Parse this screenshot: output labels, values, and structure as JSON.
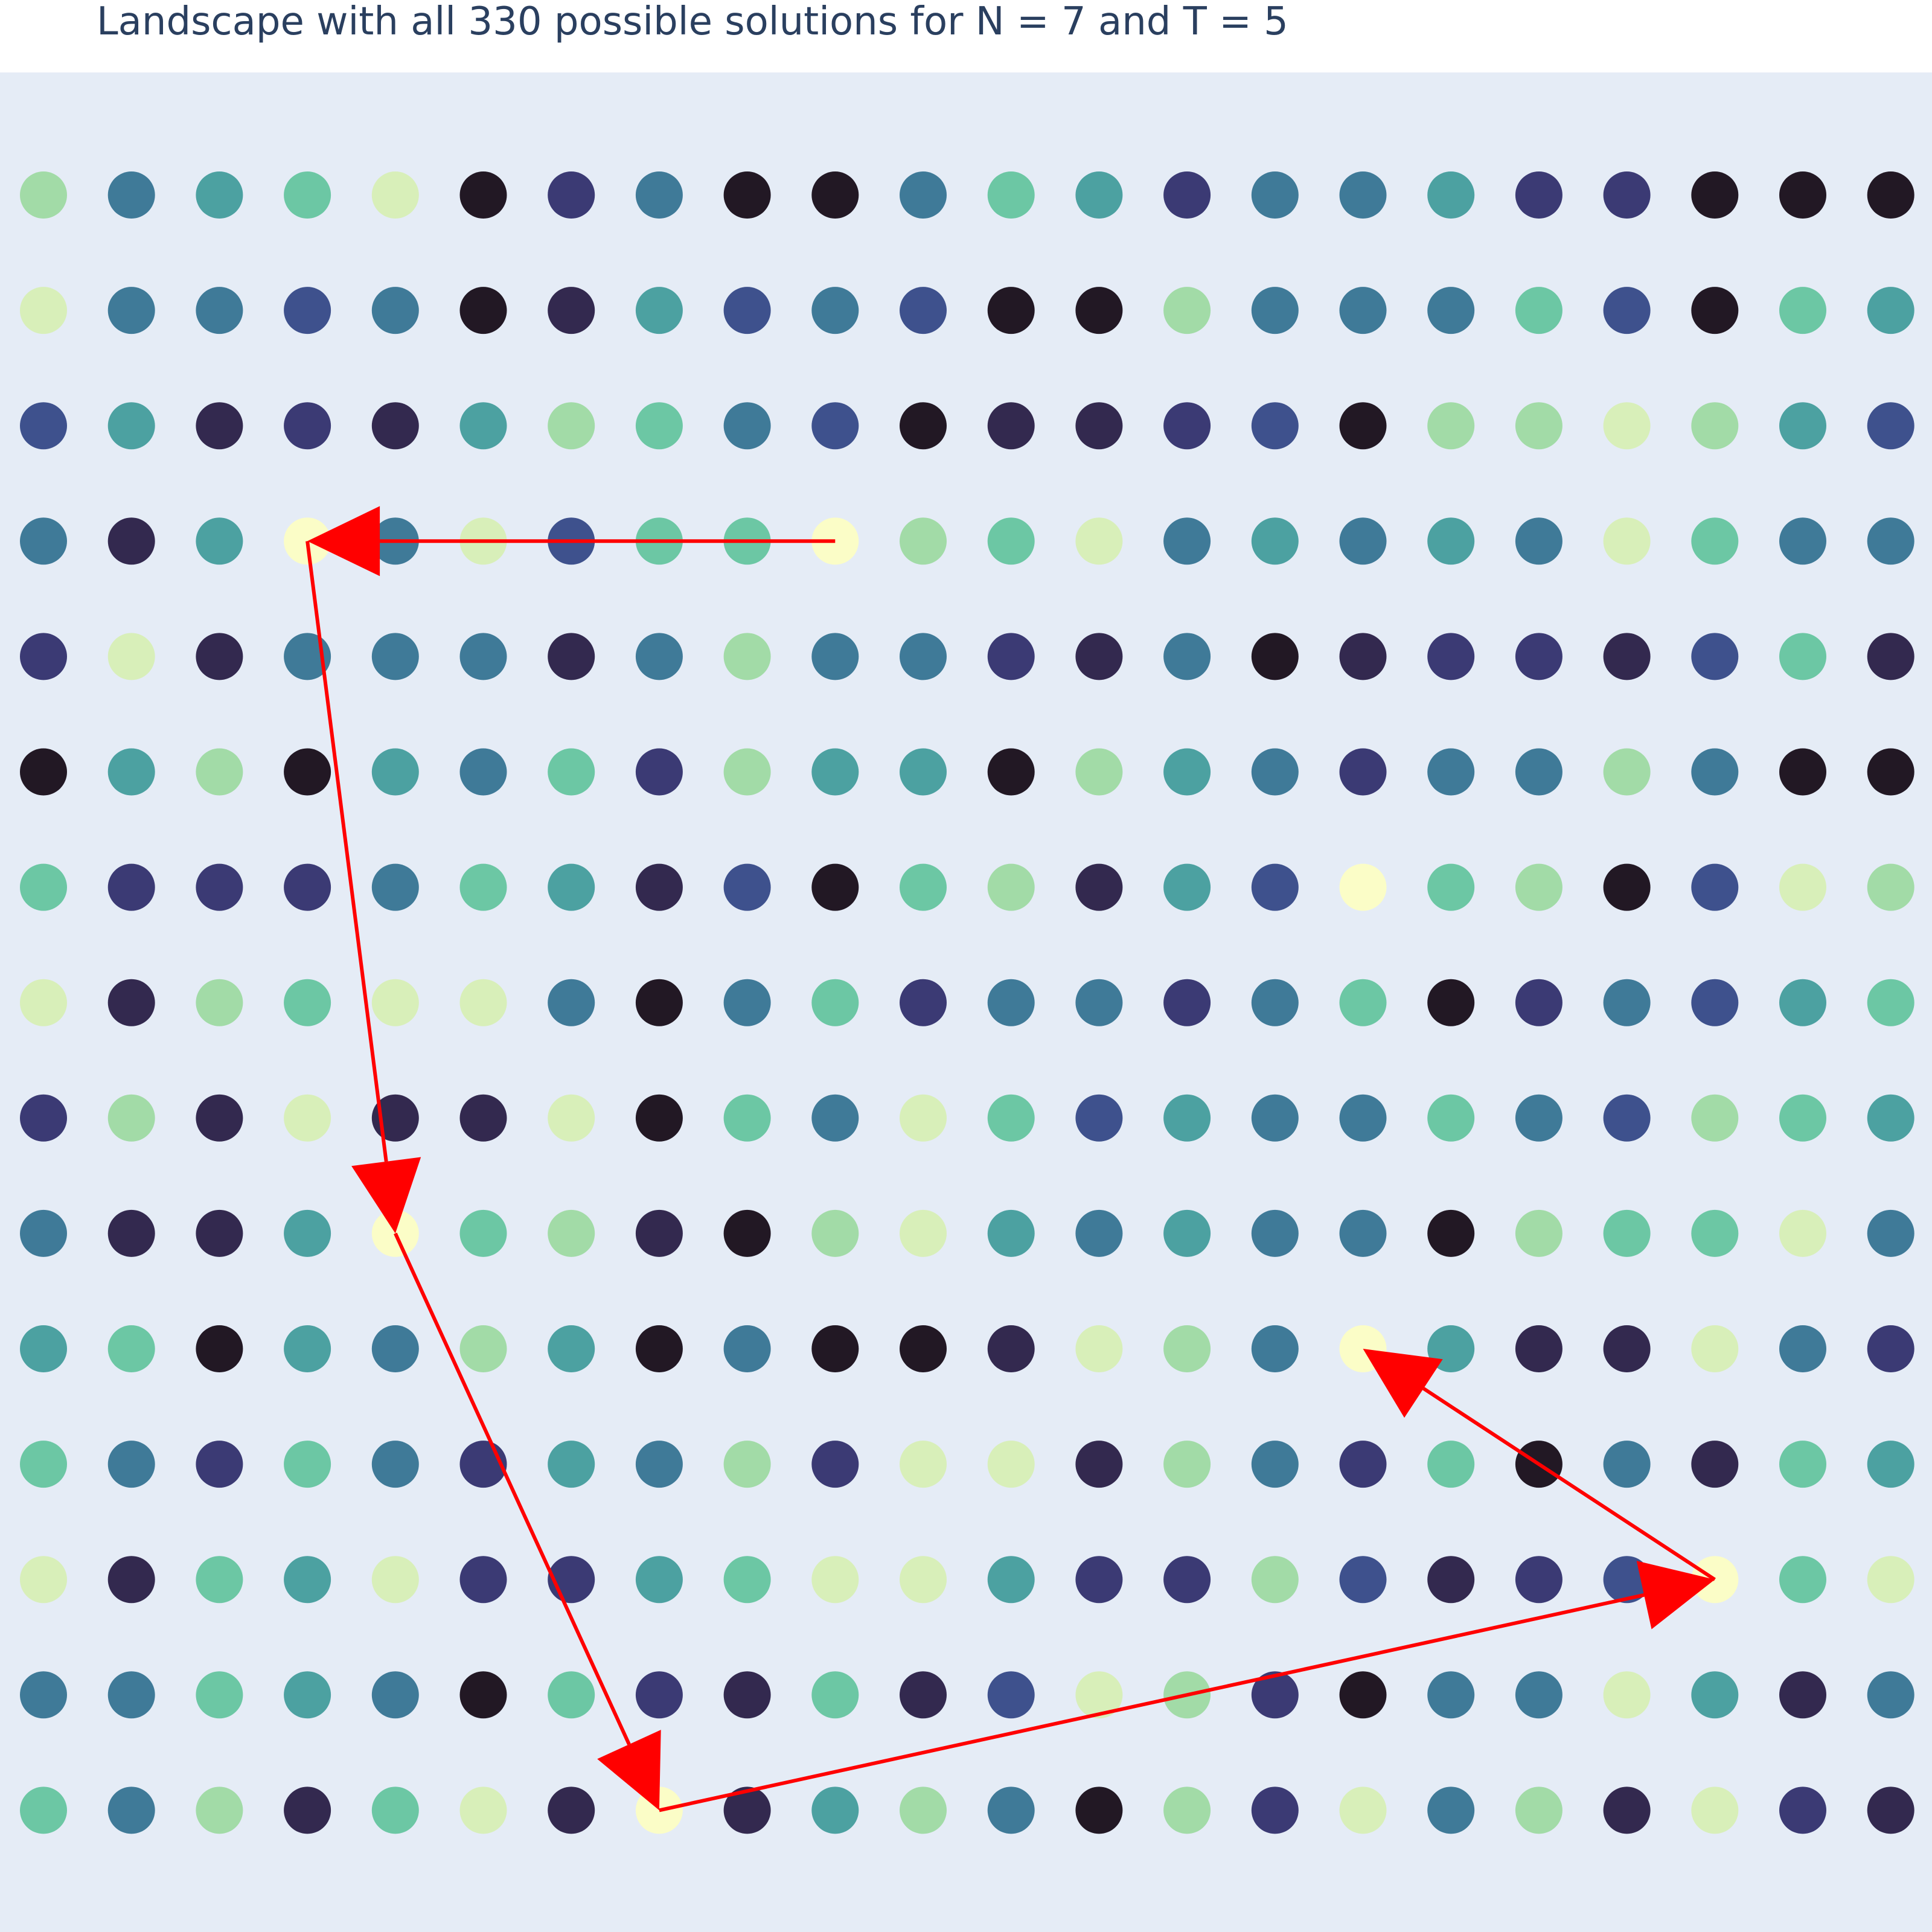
{
  "chart_data": {
    "type": "scatter",
    "title": "Landscape with all 330 possible solutions for N = 7 and T = 5",
    "xlabel": "",
    "ylabel": "",
    "grid": false,
    "colorscale": [
      "#fbfdc7",
      "#d8efb9",
      "#a2dba7",
      "#6cc7a4",
      "#4ca1a1",
      "#3f7a98",
      "#3e518d",
      "#3b3a74",
      "#33294f",
      "#221824"
    ],
    "grid_rows": 15,
    "grid_cols": 22,
    "point_levels": [
      [
        2,
        5,
        4,
        3,
        1,
        9,
        7,
        5,
        9,
        9,
        5,
        3,
        4,
        7,
        5,
        5,
        4,
        7,
        7,
        9,
        9,
        9
      ],
      [
        1,
        5,
        5,
        6,
        5,
        9,
        8,
        4,
        6,
        5,
        6,
        9,
        9,
        2,
        5,
        5,
        5,
        3,
        6,
        9,
        3,
        4
      ],
      [
        6,
        4,
        8,
        7,
        8,
        4,
        2,
        3,
        5,
        6,
        9,
        8,
        8,
        7,
        6,
        9,
        2,
        2,
        1,
        2,
        4,
        6
      ],
      [
        5,
        8,
        4,
        0,
        5,
        1,
        6,
        3,
        3,
        0,
        2,
        3,
        1,
        5,
        4,
        5,
        4,
        5,
        1,
        3,
        5,
        5
      ],
      [
        7,
        1,
        8,
        5,
        5,
        5,
        8,
        5,
        2,
        5,
        5,
        7,
        8,
        5,
        9,
        8,
        7,
        7,
        8,
        6,
        3,
        8
      ],
      [
        9,
        4,
        2,
        9,
        4,
        5,
        3,
        7,
        2,
        4,
        4,
        9,
        2,
        4,
        5,
        7,
        5,
        5,
        2,
        5,
        9,
        9
      ],
      [
        3,
        7,
        7,
        7,
        5,
        3,
        4,
        8,
        6,
        9,
        3,
        2,
        8,
        4,
        6,
        0,
        3,
        2,
        9,
        6,
        1,
        2
      ],
      [
        1,
        8,
        2,
        3,
        1,
        1,
        5,
        9,
        5,
        3,
        7,
        5,
        5,
        7,
        5,
        3,
        9,
        7,
        5,
        6,
        4,
        3
      ],
      [
        7,
        2,
        8,
        1,
        8,
        8,
        1,
        9,
        3,
        5,
        1,
        3,
        6,
        4,
        5,
        5,
        3,
        5,
        6,
        2,
        3,
        4
      ],
      [
        5,
        8,
        8,
        4,
        0,
        3,
        2,
        8,
        9,
        2,
        1,
        4,
        5,
        4,
        5,
        5,
        9,
        2,
        3,
        3,
        1,
        5
      ],
      [
        4,
        3,
        9,
        4,
        5,
        2,
        4,
        9,
        5,
        9,
        9,
        8,
        1,
        2,
        5,
        0,
        4,
        8,
        8,
        1,
        5,
        7
      ],
      [
        3,
        5,
        7,
        3,
        5,
        7,
        4,
        5,
        2,
        7,
        1,
        1,
        8,
        2,
        5,
        7,
        3,
        9,
        5,
        8,
        3,
        4
      ],
      [
        1,
        8,
        3,
        4,
        1,
        7,
        7,
        4,
        3,
        1,
        1,
        4,
        7,
        7,
        2,
        6,
        8,
        7,
        6,
        0,
        3,
        1
      ],
      [
        5,
        5,
        3,
        4,
        5,
        9,
        3,
        7,
        8,
        3,
        8,
        6,
        1,
        2,
        7,
        9,
        5,
        5,
        1,
        4,
        8,
        5
      ],
      [
        3,
        5,
        2,
        8,
        3,
        1,
        8,
        0,
        8,
        4,
        2,
        5,
        9,
        2,
        7,
        1,
        5,
        2,
        8,
        1,
        7,
        8
      ]
    ],
    "path_points": [
      {
        "row": 3,
        "col": 9
      },
      {
        "row": 3,
        "col": 3
      },
      {
        "row": 9,
        "col": 4
      },
      {
        "row": 14,
        "col": 7
      },
      {
        "row": 12,
        "col": 19
      },
      {
        "row": 10,
        "col": 15
      }
    ],
    "arrow_color": "#ff0000"
  }
}
